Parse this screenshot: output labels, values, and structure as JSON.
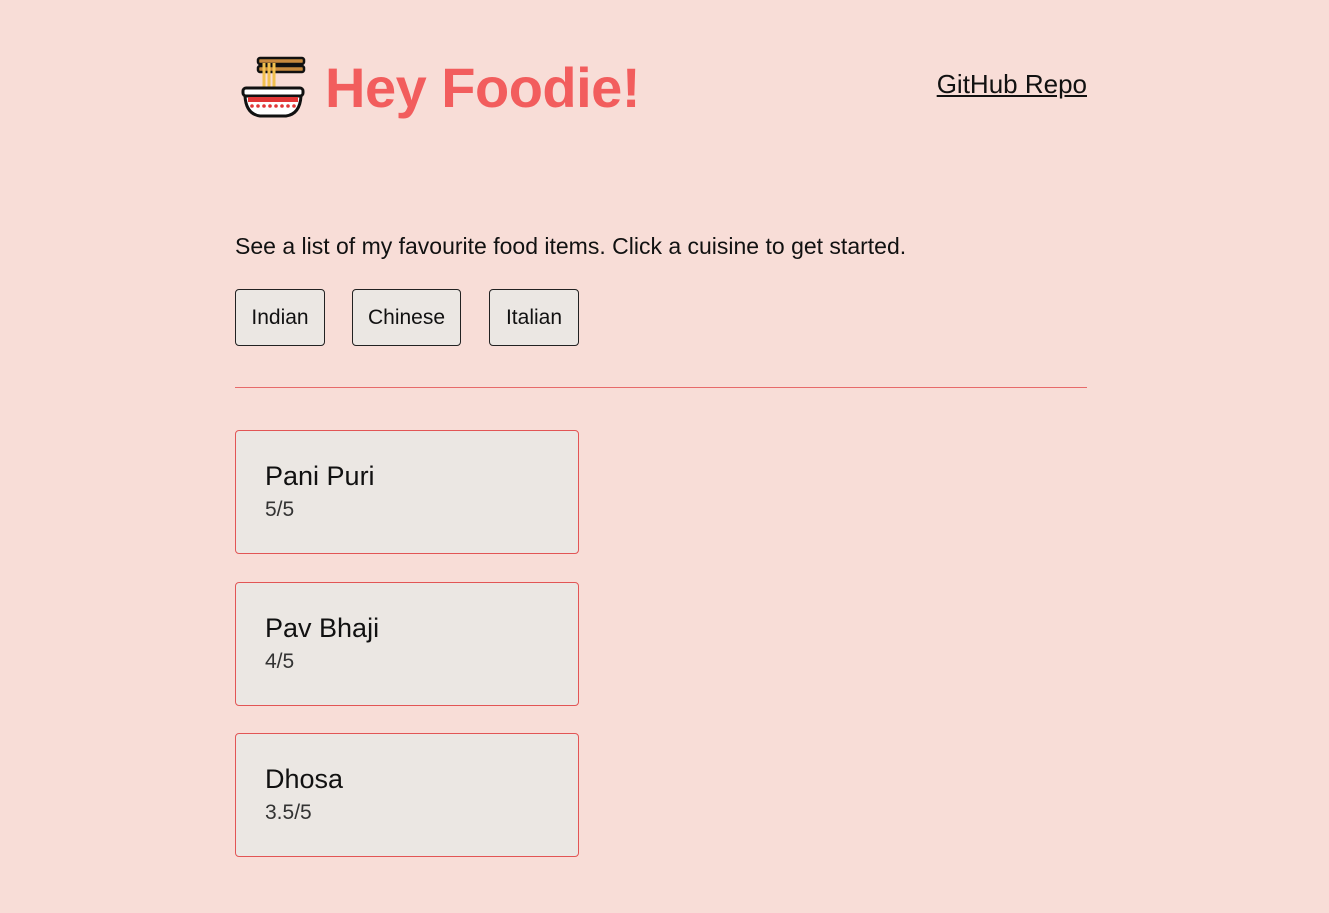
{
  "header": {
    "title": "Hey Foodie!",
    "logo_icon": "noodle-bowl-icon",
    "repo_link_label": "GitHub Repo"
  },
  "intro_text": "See a list of my favourite food items. Click a cuisine to get started.",
  "cuisines": [
    {
      "label": "Indian"
    },
    {
      "label": "Chinese"
    },
    {
      "label": "Italian"
    }
  ],
  "selected_cuisine": "Indian",
  "foods": [
    {
      "name": "Pani Puri",
      "rating": "5/5"
    },
    {
      "name": "Pav Bhaji",
      "rating": "4/5"
    },
    {
      "name": "Dhosa",
      "rating": "3.5/5"
    }
  ],
  "colors": {
    "background": "#f8ddd7",
    "accent": "#f25d5d",
    "card_background": "#ebe7e3",
    "card_border": "#e25555"
  }
}
